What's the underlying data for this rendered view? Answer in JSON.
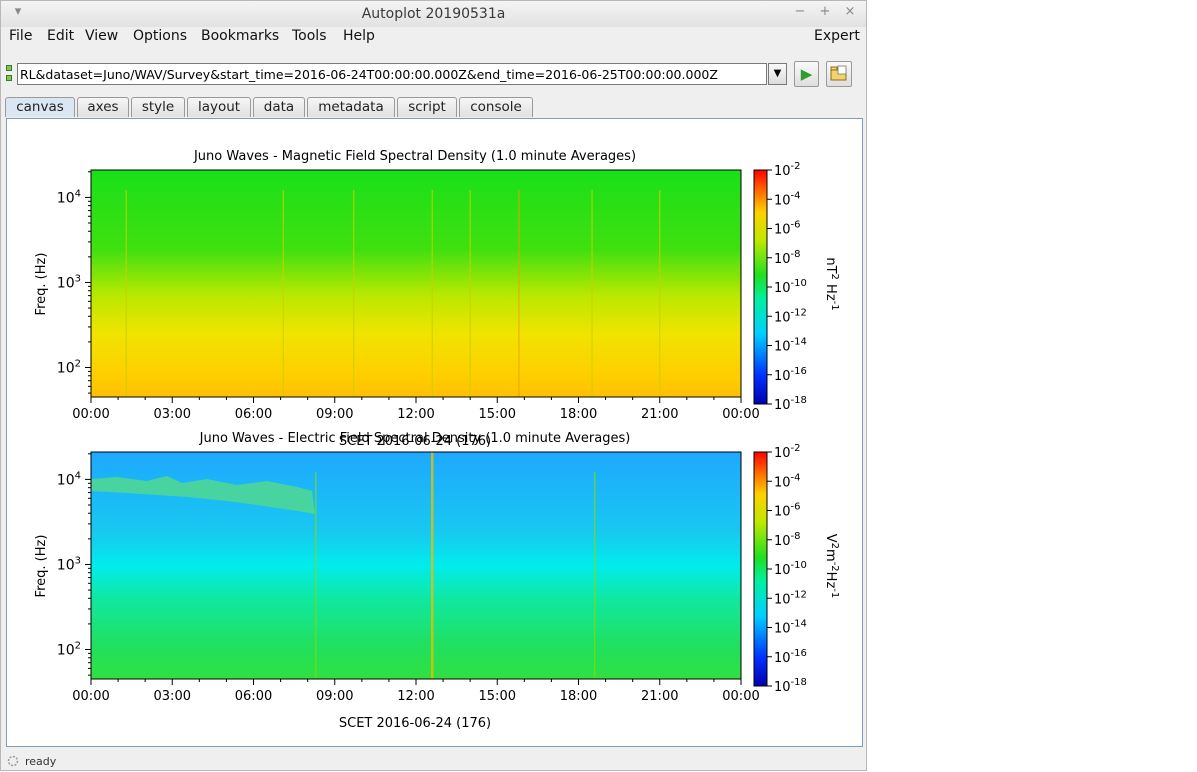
{
  "window": {
    "title": "Autoplot 20190531a"
  },
  "menus": [
    "File",
    "Edit",
    "View",
    "Options",
    "Bookmarks",
    "Tools",
    "Help"
  ],
  "expert_label": "Expert",
  "url": {
    "value": "RL&dataset=Juno/WAV/Survey&start_time=2016-06-24T00:00:00.000Z&end_time=2016-06-25T00:00:00.000Z"
  },
  "tabs": [
    "canvas",
    "axes",
    "style",
    "layout",
    "data",
    "metadata",
    "script",
    "console"
  ],
  "active_tab": "canvas",
  "status": {
    "text": "ready"
  },
  "colors": {
    "accent_tab": "#dbe6f3",
    "go_green": "#2e9d2e"
  },
  "chart_data": [
    {
      "type": "heatmap",
      "title": "Juno Waves - Magnetic Field Spectral Density (1.0 minute Averages)",
      "ylabel": "Freq. (Hz)",
      "xlabel": "SCET 2016-06-24 (176)",
      "x_ticks": [
        "00:00",
        "03:00",
        "06:00",
        "09:00",
        "12:00",
        "15:00",
        "18:00",
        "21:00",
        "00:00"
      ],
      "y_ticks": [
        {
          "base": "10",
          "exp": "2"
        },
        {
          "base": "10",
          "exp": "3"
        },
        {
          "base": "10",
          "exp": "4"
        }
      ],
      "yscale": "log",
      "ylim": [
        45,
        21000
      ],
      "colorbar": {
        "unit": {
          "base1": "nT",
          "exp1": "2",
          "base2": " Hz",
          "exp2": "-1"
        },
        "ticks": [
          "-2",
          "-4",
          "-6",
          "-8",
          "-10",
          "-12",
          "-14",
          "-16",
          "-18"
        ],
        "range": [
          1e-18,
          0.01
        ],
        "scale": "log"
      },
      "spikes_hours": [
        1.3,
        7.1,
        9.7,
        12.6,
        14.0,
        15.8,
        18.5,
        21.0
      ]
    },
    {
      "type": "heatmap",
      "title": "Juno Waves - Electric Field Spectral Density (1.0 minute Averages)",
      "ylabel": "Freq. (Hz)",
      "xlabel": "SCET 2016-06-24 (176)",
      "x_ticks": [
        "00:00",
        "03:00",
        "06:00",
        "09:00",
        "12:00",
        "15:00",
        "18:00",
        "21:00",
        "00:00"
      ],
      "y_ticks": [
        {
          "base": "10",
          "exp": "2"
        },
        {
          "base": "10",
          "exp": "3"
        },
        {
          "base": "10",
          "exp": "4"
        }
      ],
      "yscale": "log",
      "ylim": [
        45,
        21000
      ],
      "colorbar": {
        "unit": {
          "base1": "V",
          "exp1": "2",
          "base2": "m",
          "exp2": "-2",
          "base3": "Hz",
          "exp3": "-1"
        },
        "ticks": [
          "-2",
          "-4",
          "-6",
          "-8",
          "-10",
          "-12",
          "-14",
          "-16",
          "-18"
        ],
        "range": [
          1e-18,
          0.01
        ],
        "scale": "log"
      },
      "spikes_hours": [
        8.3,
        12.6,
        18.6
      ]
    }
  ]
}
